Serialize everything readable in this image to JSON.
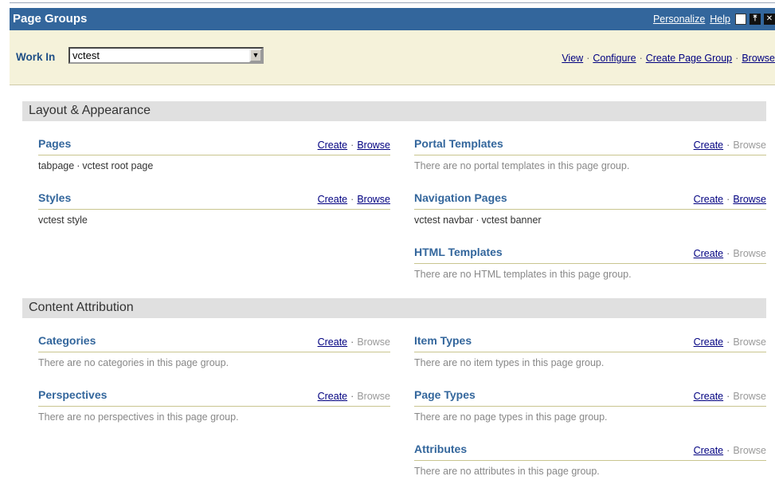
{
  "header": {
    "title": "Page Groups",
    "personalize": "Personalize",
    "help": "Help"
  },
  "workin": {
    "label": "Work In",
    "value": "vctest",
    "actions": [
      "View",
      "Configure",
      "Create Page Group",
      "Browse"
    ]
  },
  "sections": {
    "layout": "Layout & Appearance",
    "content": "Content Attribution"
  },
  "groups": {
    "pages": {
      "title": "Pages",
      "create": "Create",
      "browse": "Browse",
      "items": [
        "tabpage",
        "vctest root page"
      ]
    },
    "styles": {
      "title": "Styles",
      "create": "Create",
      "browse": "Browse",
      "items": [
        "vctest style"
      ]
    },
    "portal_templates": {
      "title": "Portal Templates",
      "create": "Create",
      "browse": "Browse",
      "empty": "There are no portal templates in this page group."
    },
    "navigation_pages": {
      "title": "Navigation Pages",
      "create": "Create",
      "browse": "Browse",
      "items": [
        "vctest navbar",
        "vctest banner"
      ]
    },
    "html_templates": {
      "title": "HTML Templates",
      "create": "Create",
      "browse": "Browse",
      "empty": "There are no HTML templates in this page group."
    },
    "categories": {
      "title": "Categories",
      "create": "Create",
      "browse": "Browse",
      "empty": "There are no categories in this page group."
    },
    "perspectives": {
      "title": "Perspectives",
      "create": "Create",
      "browse": "Browse",
      "empty": "There are no perspectives in this page group."
    },
    "item_types": {
      "title": "Item Types",
      "create": "Create",
      "browse": "Browse",
      "empty": "There are no item types in this page group."
    },
    "page_types": {
      "title": "Page Types",
      "create": "Create",
      "browse": "Browse",
      "empty": "There are no page types in this page group."
    },
    "attributes": {
      "title": "Attributes",
      "create": "Create",
      "browse": "Browse",
      "empty": "There are no attributes in this page group."
    }
  },
  "colors": {
    "titlebar": "#33669c",
    "workbar": "#f5f2da",
    "section_head": "#e0e0e0",
    "group_title": "#33669c",
    "link": "#000080"
  }
}
